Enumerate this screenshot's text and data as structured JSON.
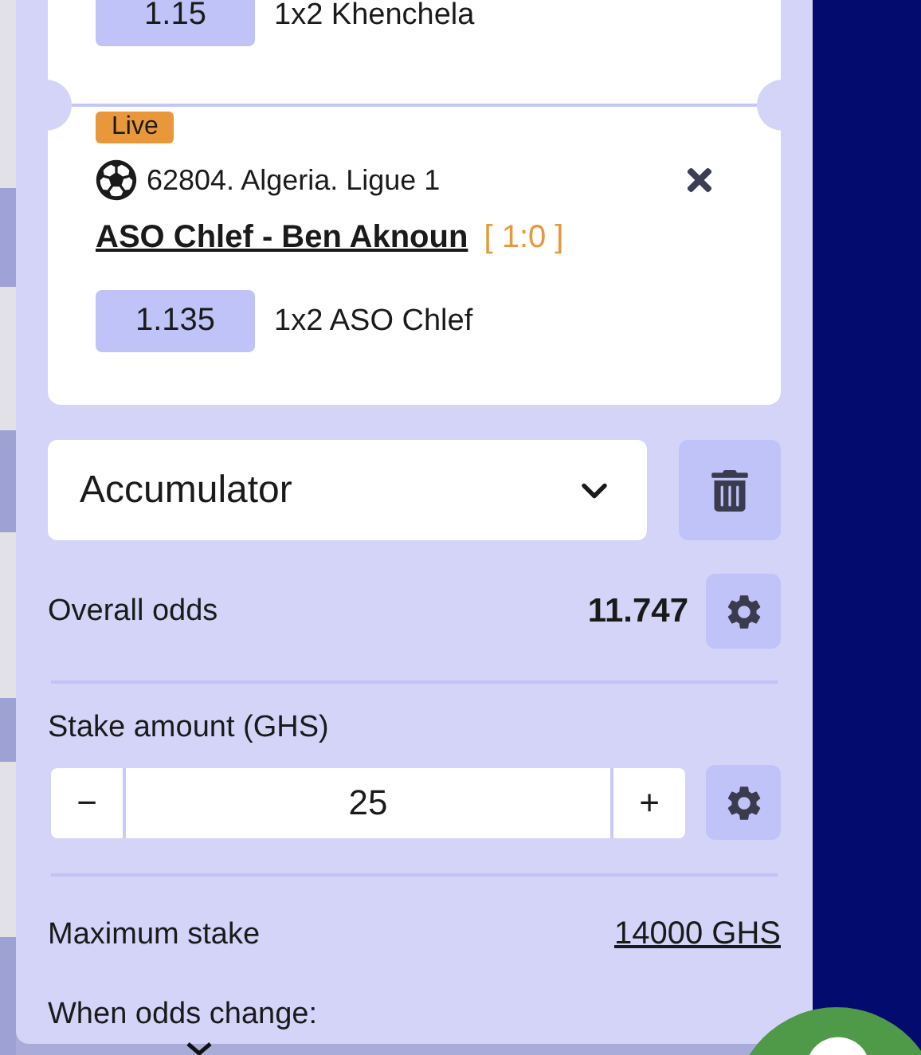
{
  "bets": [
    {
      "odds": "1.15",
      "market": "1x2 Khenchela"
    },
    {
      "badge": "Live",
      "league": "62804. Algeria. Ligue 1",
      "match": "ASO Chlef - Ben Aknoun",
      "score": "[ 1:0 ]",
      "odds": "1.135",
      "market": "1x2 ASO Chlef"
    }
  ],
  "bet_type": {
    "value": "Accumulator"
  },
  "overall_odds": {
    "label": "Overall odds",
    "value": "11.747"
  },
  "stake": {
    "label": "Stake amount (GHS)",
    "minus": "−",
    "value": "25",
    "plus": "+"
  },
  "maximum_stake": {
    "label": "Maximum stake",
    "value": "14000 GHS"
  },
  "odds_change": {
    "label": "When odds change:"
  }
}
